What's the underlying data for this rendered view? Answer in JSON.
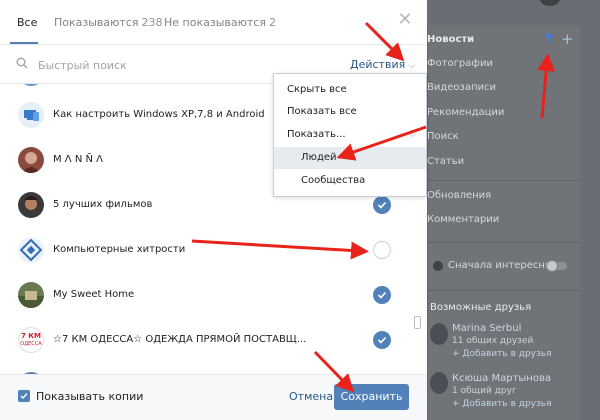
{
  "tabs": [
    {
      "label": "Все",
      "count": ""
    },
    {
      "label": "Показываются",
      "count": "238"
    },
    {
      "label": "Не показываются",
      "count": "2"
    }
  ],
  "search": {
    "placeholder": "Быстрый поиск"
  },
  "actions_label": "Действия",
  "dropdown": {
    "hide_all": "Скрыть все",
    "show_all": "Показать все",
    "show": "Показать...",
    "people": "Людей",
    "communities": "Сообщества"
  },
  "list": [
    {
      "label": "Как настроить Windows XP,7,8 и Android",
      "checked": null
    },
    {
      "label": "M Λ N Ñ Λ",
      "checked": null
    },
    {
      "label": "5 лучших фильмов",
      "checked": true
    },
    {
      "label": "Компьютерные хитрости",
      "checked": false
    },
    {
      "label": "My Sweet Home",
      "checked": true
    },
    {
      "label": "☆7 КМ ОДЕССА☆ ОДЕЖДА ПРЯМОЙ ПОСТАВЩ...",
      "checked": true
    }
  ],
  "avatar_texts": {
    "odessa_line1": "7 КМ",
    "odessa_line2": "ОДЕССА"
  },
  "footer": {
    "show_copies": "Показывать копии",
    "cancel": "Отмена",
    "save": "Сохранить"
  },
  "background": {
    "news_title": "Новости",
    "items": [
      "Фотографии",
      "Видеозаписи",
      "Рекомендации",
      "Поиск",
      "Статьи",
      "Обновления",
      "Комментарии"
    ],
    "interesting_first": "Сначала интересные",
    "possible_friends": "Возможные друзья",
    "friends": [
      {
        "name": "Marina Serbul",
        "mutual": "11 общих друзей",
        "add": "+ Добавить в друзья"
      },
      {
        "name": "Ксюша Мартынова",
        "mutual": "1 общий друг",
        "add": "+ Добавить в друзья"
      }
    ]
  },
  "colors": {
    "accent": "#5181b8",
    "link": "#2a5885",
    "annotation_arrow": "#e8231c"
  }
}
